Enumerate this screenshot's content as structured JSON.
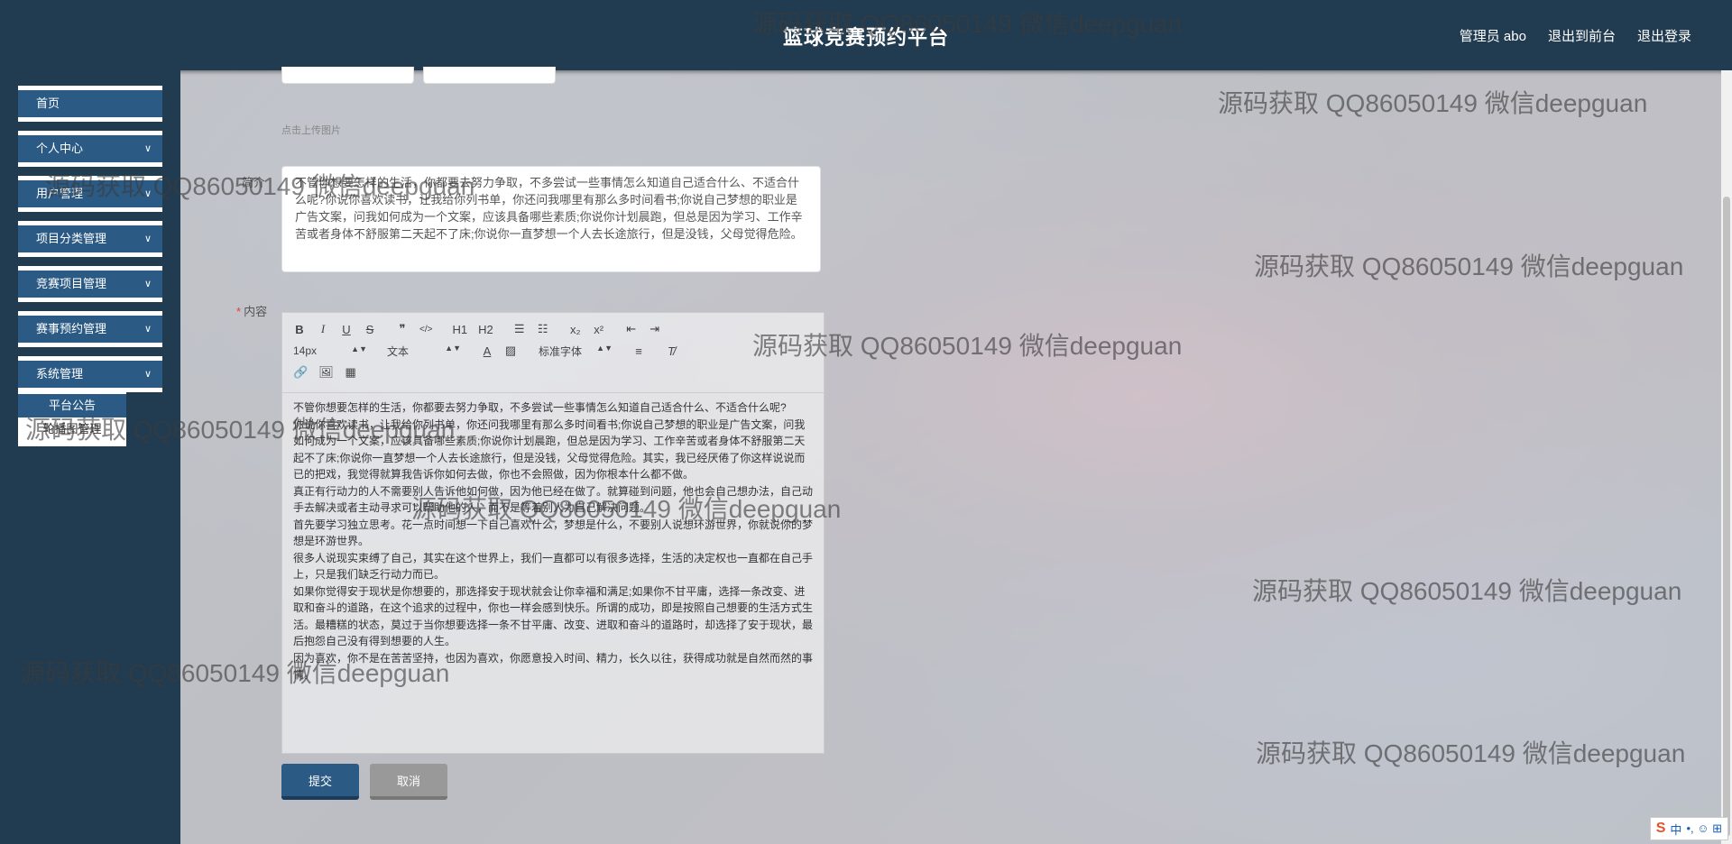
{
  "header": {
    "title": "篮球竞赛预约平台",
    "nav": [
      "管理员 abo",
      "退出到前台",
      "退出登录"
    ]
  },
  "sidebar": {
    "items": [
      {
        "label": "首页",
        "has_submenu": false
      },
      {
        "label": "个人中心",
        "has_submenu": true
      },
      {
        "label": "用户管理",
        "has_submenu": true
      },
      {
        "label": "项目分类管理",
        "has_submenu": true
      },
      {
        "label": "竞赛项目管理",
        "has_submenu": true
      },
      {
        "label": "赛事预约管理",
        "has_submenu": true
      },
      {
        "label": "系统管理",
        "has_submenu": true
      }
    ],
    "submenu": {
      "active": "平台公告",
      "other": "轮播图管理"
    },
    "chevron_icon": "chevron-down-icon"
  },
  "form": {
    "upload_hint": "点击上传图片",
    "summary_label": "简介",
    "summary_text": "不管你想要怎样的生活，你都要去努力争取，不多尝试一些事情怎么知道自己适合什么、不适合什么呢?你说你喜欢读书，让我给你列书单，你还问我哪里有那么多时间看书;你说自己梦想的职业是广告文案，问我如何成为一个文案，应该具备哪些素质;你说你计划晨跑，但总是因为学习、工作辛苦或者身体不舒服第二天起不了床;你说你一直梦想一个人去长途旅行，但是没钱，父母觉得危险。",
    "content_label": "内容",
    "required_mark": "*",
    "toolbar": {
      "row1": [
        "B",
        "I",
        "U",
        "S",
        "❞",
        "</>",
        "H1",
        "H2",
        "☰",
        "☷",
        "x₂",
        "x²",
        "⇤",
        "⇥"
      ],
      "font_size": "14px",
      "font_type": "文本",
      "color_icon": "A",
      "bg_icon": "▨",
      "font_family": "标准字体",
      "align_icon": "≡",
      "clear_icon": "T̸",
      "row3": [
        "link-icon",
        "image-icon",
        "video-icon"
      ]
    },
    "content_paragraphs": [
      "不管你想要怎样的生活，你都要去努力争取，不多尝试一些事情怎么知道自己适合什么、不适合什么呢?",
      "你说你喜欢读书，让我给你列书单，你还问我哪里有那么多时间看书;你说自己梦想的职业是广告文案，问我如何成为一个文案，应该具备哪些素质;你说你计划晨跑，但总是因为学习、工作辛苦或者身体不舒服第二天起不了床;你说你一直梦想一个人去长途旅行，但是没钱，父母觉得危险。其实，我已经厌倦了你这样说说而已的把戏，我觉得就算我告诉你如何去做，你也不会照做，因为你根本什么都不做。",
      "真正有行动力的人不需要别人告诉他如何做，因为他已经在做了。就算碰到问题，他也会自己想办法，自己动手去解决或者主动寻求可以帮助他的人，而不是等着别人为自己解决问题。",
      "首先要学习独立思考。花一点时间想一下自己喜欢什么，梦想是什么，不要别人说想环游世界，你就说你的梦想是环游世界。",
      "很多人说现实束缚了自己，其实在这个世界上，我们一直都可以有很多选择，生活的决定权也一直都在自己手上，只是我们缺乏行动力而已。",
      "如果你觉得安于现状是你想要的，那选择安于现状就会让你幸福和满足;如果你不甘平庸，选择一条改变、进取和奋斗的道路，在这个追求的过程中，你也一样会感到快乐。所谓的成功，即是按照自己想要的生活方式生活。最糟糕的状态，莫过于当你想要选择一条不甘平庸、改变、进取和奋斗的道路时，却选择了安于现状，最后抱怨自己没有得到想要的人生。",
      "因为喜欢，你不是在苦苦坚持，也因为喜欢，你愿意投入时间、精力，长久以往，获得成功就是自然而然的事情。"
    ],
    "submit_label": "提交",
    "cancel_label": "取消"
  },
  "watermark_text": "源码获取 QQ86050149 微信deepguan",
  "ime": {
    "logo": "S",
    "lang": "中",
    "extras": "•, ☺ ⊞"
  }
}
